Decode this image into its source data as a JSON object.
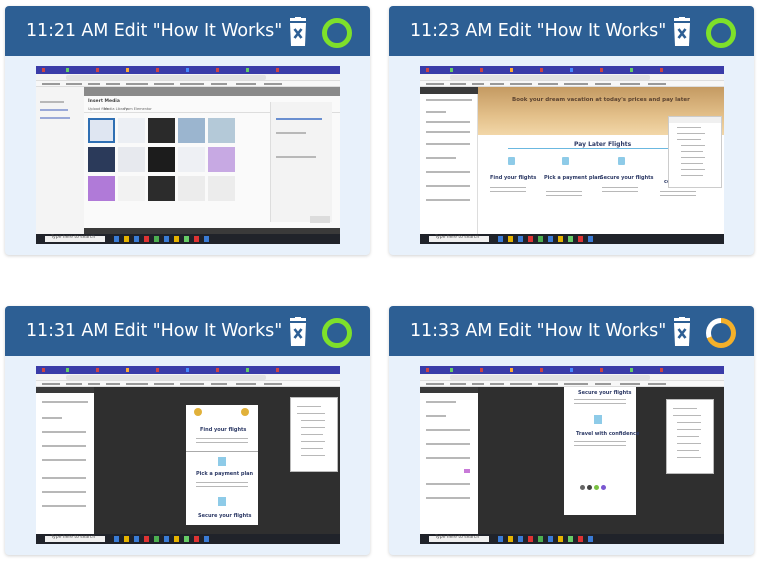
{
  "cards": [
    {
      "title": "11:21 AM  Edit \"How It Works\" ...",
      "status": "complete",
      "status_color": "#7ee02a",
      "thumbnail": {
        "modal_title": "Insert Media",
        "tabs": [
          "Upload files",
          "Media Library",
          "From Elementor"
        ]
      }
    },
    {
      "title": "11:23 AM  Edit \"How It Works\" ...",
      "status": "complete",
      "status_color": "#7ee02a",
      "thumbnail": {
        "hero_text": "Book your dream vacation at today's prices and pay later",
        "section_title": "Pay Later Flights",
        "steps": [
          "Find your flights",
          "Pick a payment plan",
          "Secure your flights",
          "confidence"
        ]
      }
    },
    {
      "title": "11:31 AM  Edit \"How It Works\" ...",
      "status": "complete",
      "status_color": "#7ee02a",
      "thumbnail": {
        "steps": [
          "Find your flights",
          "Pick a payment plan",
          "Secure your flights"
        ]
      }
    },
    {
      "title": "11:33 AM  Edit \"How It Works\" ...",
      "status": "in-progress",
      "status_color": "#f4b02a",
      "thumbnail": {
        "steps": [
          "Secure your flights",
          "Travel with confidence"
        ]
      }
    }
  ],
  "taskbar": {
    "search_placeholder": "Type here to search"
  },
  "header_color": "#2d5f94",
  "card_background": "#e8f1fb"
}
